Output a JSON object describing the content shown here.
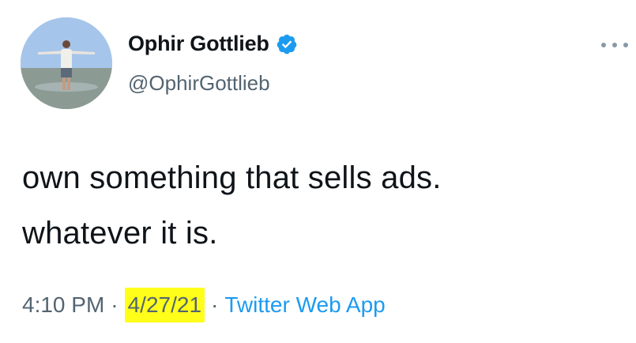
{
  "author": {
    "display_name": "Ophir Gottlieb",
    "handle": "@OphirGottlieb",
    "verified": true,
    "avatar": "person-arms-outstretched-on-salt-flat"
  },
  "tweet": {
    "lines": [
      "own something that sells ads.",
      "whatever it is."
    ]
  },
  "meta": {
    "time": "4:10 PM",
    "separator": "·",
    "date": "4/27/21",
    "source": "Twitter Web App"
  },
  "colors": {
    "text": "#0f1419",
    "secondary": "#536471",
    "link": "#1d9bf0",
    "verified": "#1d9bf0",
    "highlight": "#ffff1a"
  },
  "icons": {
    "more": "more-horizontal-icon",
    "verified": "verified-badge-icon"
  }
}
